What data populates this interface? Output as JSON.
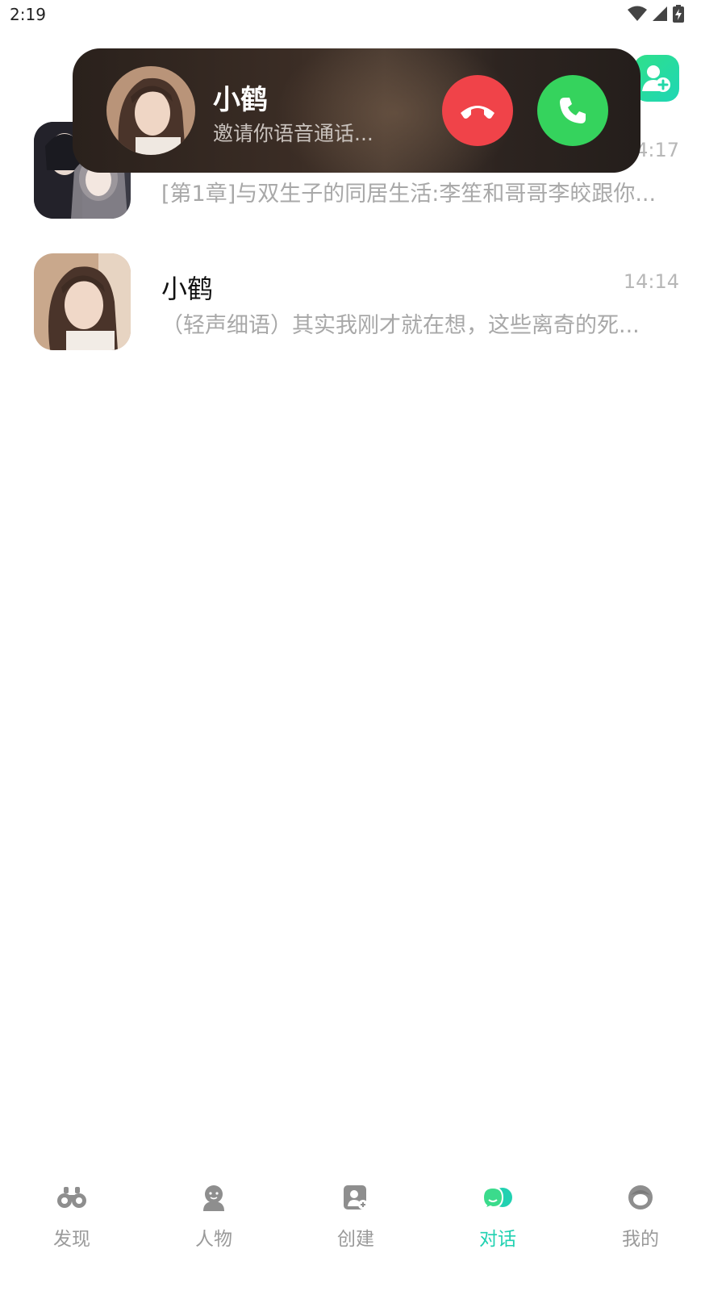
{
  "status_bar": {
    "time": "2:19",
    "icons": [
      "wifi-icon",
      "signal-icon",
      "battery-charging-icon"
    ]
  },
  "header": {
    "add_button_icon": "add-contact-icon",
    "accent_gradient": [
      "#2fe08a",
      "#1fd6b5"
    ]
  },
  "incoming_call": {
    "caller_name": "小鹤",
    "status_text": "邀请你语音通话...",
    "decline_icon": "hang-up-icon",
    "accept_icon": "phone-icon",
    "decline_color": "#f04349",
    "accept_color": "#35d35d"
  },
  "chats": [
    {
      "name": "",
      "time": "4:17",
      "preview": "[第1章]与双生子的同居生活:李笙和哥哥李皎跟你..."
    },
    {
      "name": "小鹤",
      "time": "14:14",
      "preview": "（轻声细语）其实我刚才就在想，这些离奇的死..."
    }
  ],
  "bottom_nav": {
    "active_color": "#21d1b1",
    "items": [
      {
        "label": "发现",
        "icon": "binoculars-icon"
      },
      {
        "label": "人物",
        "icon": "person-icon"
      },
      {
        "label": "创建",
        "icon": "create-contact-icon"
      },
      {
        "label": "对话",
        "icon": "chat-bubble-icon",
        "active": true
      },
      {
        "label": "我的",
        "icon": "profile-icon"
      }
    ]
  }
}
